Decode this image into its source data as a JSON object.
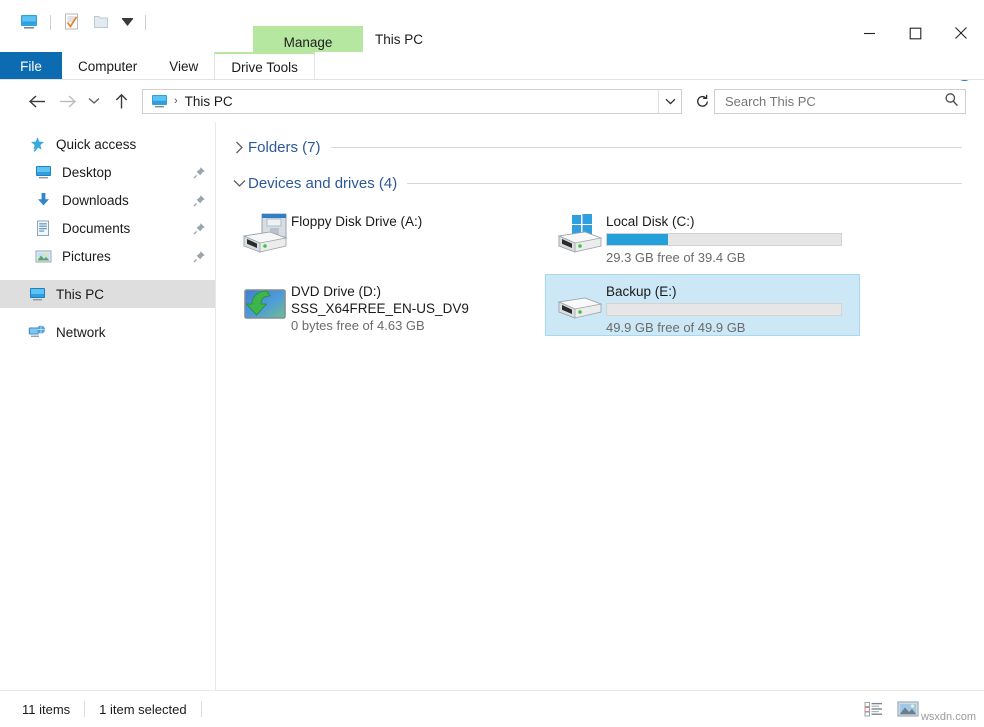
{
  "window": {
    "title": "This PC",
    "contextual_tab_group": "Manage",
    "controls": {
      "minimize": "minimize-icon",
      "maximize": "maximize-icon",
      "close": "close-icon"
    }
  },
  "quick_access_toolbar": {
    "items": [
      {
        "name": "this-pc-icon",
        "tooltip": "This PC"
      },
      {
        "name": "properties-icon",
        "tooltip": "Properties"
      },
      {
        "name": "new-folder-icon",
        "tooltip": "New folder"
      },
      {
        "name": "customize-dropdown-icon",
        "tooltip": "Customize Quick Access Toolbar"
      }
    ]
  },
  "ribbon": {
    "tabs": [
      {
        "label": "File",
        "active": true
      },
      {
        "label": "Computer",
        "active": false
      },
      {
        "label": "View",
        "active": false
      },
      {
        "label": "Drive Tools",
        "active": true
      }
    ],
    "collapse_label": "⌄",
    "help_label": "?"
  },
  "address_bar": {
    "back": "back-arrow-icon",
    "forward": "forward-arrow-icon",
    "recent": "recent-locations-chevron-icon",
    "up": "up-arrow-icon",
    "breadcrumb": {
      "icon": "this-pc-icon",
      "separator": "›",
      "path": "This PC"
    },
    "dropdown": "⌄",
    "refresh": "refresh-icon"
  },
  "search": {
    "placeholder": "Search This PC",
    "icon": "search-icon"
  },
  "sidebar": {
    "items": [
      {
        "label": "Quick access",
        "icon": "star-pin-icon",
        "level": "root",
        "pinned": false,
        "selected": false
      },
      {
        "label": "Desktop",
        "icon": "desktop-icon",
        "level": "child",
        "pinned": true,
        "selected": false
      },
      {
        "label": "Downloads",
        "icon": "downloads-icon",
        "level": "child",
        "pinned": true,
        "selected": false
      },
      {
        "label": "Documents",
        "icon": "documents-icon",
        "level": "child",
        "pinned": true,
        "selected": false
      },
      {
        "label": "Pictures",
        "icon": "pictures-icon",
        "level": "child",
        "pinned": true,
        "selected": false
      },
      {
        "label": "This PC",
        "icon": "this-pc-icon",
        "level": "root",
        "pinned": false,
        "selected": true
      },
      {
        "label": "Network",
        "icon": "network-icon",
        "level": "root",
        "pinned": false,
        "selected": false
      }
    ]
  },
  "content": {
    "groups": [
      {
        "label": "Folders (7)",
        "expanded": false,
        "chevron": "›"
      },
      {
        "label": "Devices and drives (4)",
        "expanded": true,
        "chevron": "⌄"
      }
    ],
    "drives": [
      {
        "name": "Floppy Disk Drive (A:)",
        "volume_label": "",
        "free_text": "",
        "icon": "floppy-drive-icon",
        "has_bar": false,
        "fill_percent": 0,
        "selected": false
      },
      {
        "name": "Local Disk (C:)",
        "volume_label": "",
        "free_text": "29.3 GB free of 39.4 GB",
        "icon": "windows-drive-icon",
        "has_bar": true,
        "fill_percent": 26,
        "selected": false
      },
      {
        "name": "DVD Drive (D:)",
        "volume_label": "SSS_X64FREE_EN-US_DV9",
        "free_text": "0 bytes free of 4.63 GB",
        "icon": "dvd-drive-icon",
        "has_bar": false,
        "fill_percent": 100,
        "selected": false
      },
      {
        "name": "Backup (E:)",
        "volume_label": "",
        "free_text": "49.9 GB free of 49.9 GB",
        "icon": "hard-drive-icon",
        "has_bar": true,
        "fill_percent": 0,
        "selected": true
      }
    ]
  },
  "status_bar": {
    "item_count": "11 items",
    "selection": "1 item selected",
    "view_details_icon": "details-view-icon",
    "view_large_icons_icon": "large-icons-view-icon"
  },
  "watermark": "wsxdn.com",
  "colors": {
    "file_tab_blue": "#0d6bb1",
    "contextual_green": "#b5e7a0",
    "group_header_blue": "#2c5898",
    "selection_blue": "#cce8f7",
    "bar_fill_blue": "#26a0da",
    "help_blue": "#1277c4"
  }
}
